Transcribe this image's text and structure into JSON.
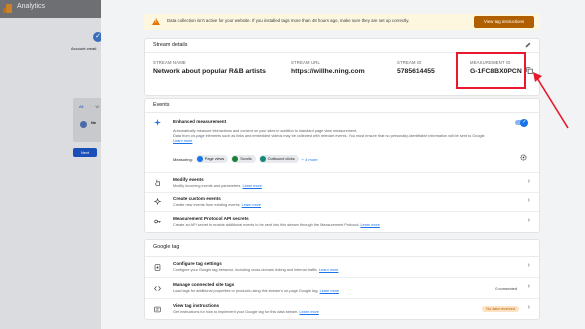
{
  "app": {
    "title": "Analytics"
  },
  "background": {
    "step_label": "Account creati",
    "tabs": [
      "All",
      "W"
    ],
    "item_text": "Ne",
    "next_label": "Next"
  },
  "alert": {
    "text": "Data collection isn't active for your website. If you installed tags more than 48 hours ago, make sure they are set up correctly.",
    "button": "View tag instructions"
  },
  "stream_details": {
    "heading": "Stream details",
    "stream_name_label": "STREAM NAME",
    "stream_name": "Network about popular R&B artists",
    "stream_url_label": "STREAM URL",
    "stream_url": "https://willhe.ning.com",
    "stream_id_label": "STREAM ID",
    "stream_id": "5785614455",
    "measurement_id_label": "MEASUREMENT ID",
    "measurement_id": "G-1FC8BX0PCN"
  },
  "events": {
    "heading": "Events",
    "enhanced": {
      "title": "Enhanced measurement",
      "desc1": "Automatically measure interactions and content on your sites in addition to standard page view measurement.",
      "desc2": "Data from on-page elements such as links and embedded videos may be collected with relevant events. You must ensure that no personally-identifiable information will be sent to Google.",
      "learn_more": "Learn more",
      "measuring_label": "Measuring:",
      "chips": [
        {
          "label": "Page views",
          "color": "#1a73e8"
        },
        {
          "label": "Scrolls",
          "color": "#188038"
        },
        {
          "label": "Outbound clicks",
          "color": "#12877a"
        }
      ],
      "more": "+ 4 more"
    },
    "rows": [
      {
        "title": "Modify events",
        "desc": "Modify incoming events and parameters.",
        "link": "Learn more"
      },
      {
        "title": "Create custom events",
        "desc": "Create new events from existing events.",
        "link": "Learn more"
      },
      {
        "title": "Measurement Protocol API secrets",
        "desc": "Create an API secret to enable additional events to be sent into this stream through the Measurement Protocol.",
        "link": "Learn more"
      }
    ]
  },
  "google_tag": {
    "heading": "Google tag",
    "rows": [
      {
        "title": "Configure tag settings",
        "desc": "Configure your Google tag behavior, including cross-domain linking and internal traffic.",
        "link": "Learn more",
        "badge": ""
      },
      {
        "title": "Manage connected site tags",
        "desc": "Load tags for additional properties or products using this stream's on-page Google tag.",
        "link": "Learn more",
        "badge": "0 connected"
      },
      {
        "title": "View tag instructions",
        "desc": "Get instructions for how to implement your Google tag for this data stream.",
        "link": "Learn more",
        "badge": "No data received"
      }
    ]
  },
  "colors": {
    "highlight": "#e8192c",
    "accent": "#1a73e8",
    "warn_button": "#b06000"
  }
}
